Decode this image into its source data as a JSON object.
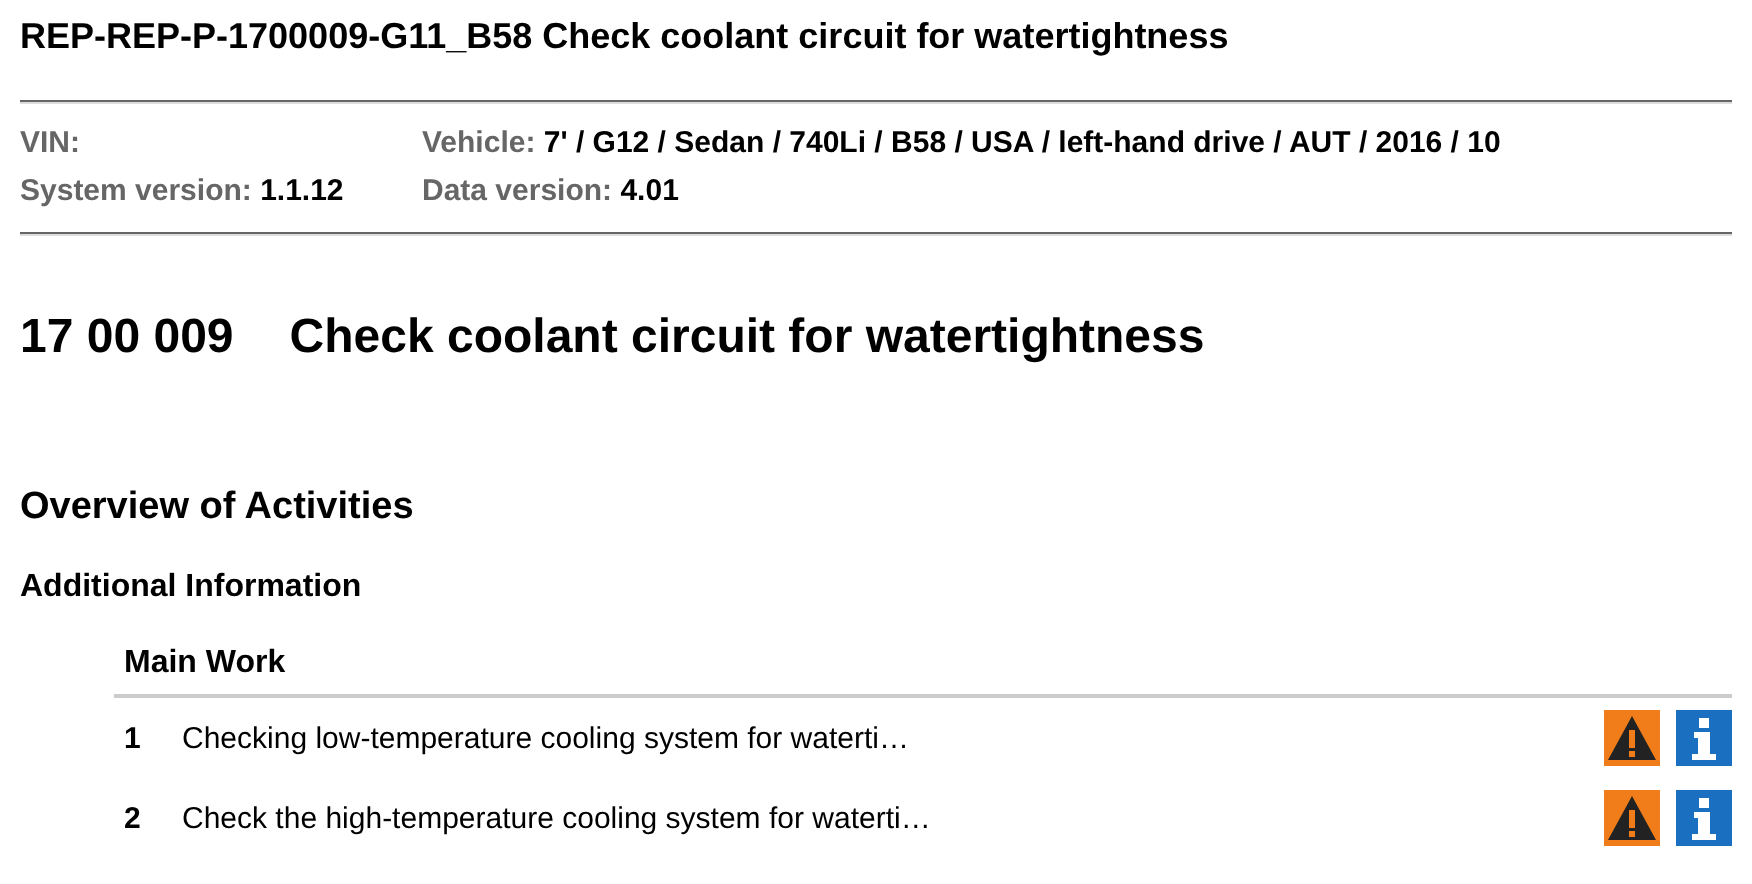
{
  "document_title": "REP-REP-P-1700009-G11_B58 Check coolant circuit for watertightness",
  "meta": [
    {
      "label": "VIN:"
    },
    {
      "label": "Vehicle:",
      "value": "7' / G12 / Sedan / 740Li / B58 / USA / left-hand drive / AUT / 2016 / 10"
    },
    {
      "label": "System version:",
      "value": "1.1.12"
    },
    {
      "label": "Data version:",
      "value": "4.01"
    }
  ],
  "procedure": {
    "number": "17 00 009",
    "title": "Check coolant circuit for watertightness"
  },
  "section_title": "Overview of Activities",
  "subsection_title": "Additional Information",
  "table": {
    "heading": "Main Work",
    "rows": [
      {
        "number": "1",
        "text": "Checking low-temperature cooling system for waterti…",
        "warning": true,
        "info": true
      },
      {
        "number": "2",
        "text": "Check the high-temperature cooling system for waterti…",
        "warning": true,
        "info": true
      }
    ]
  }
}
